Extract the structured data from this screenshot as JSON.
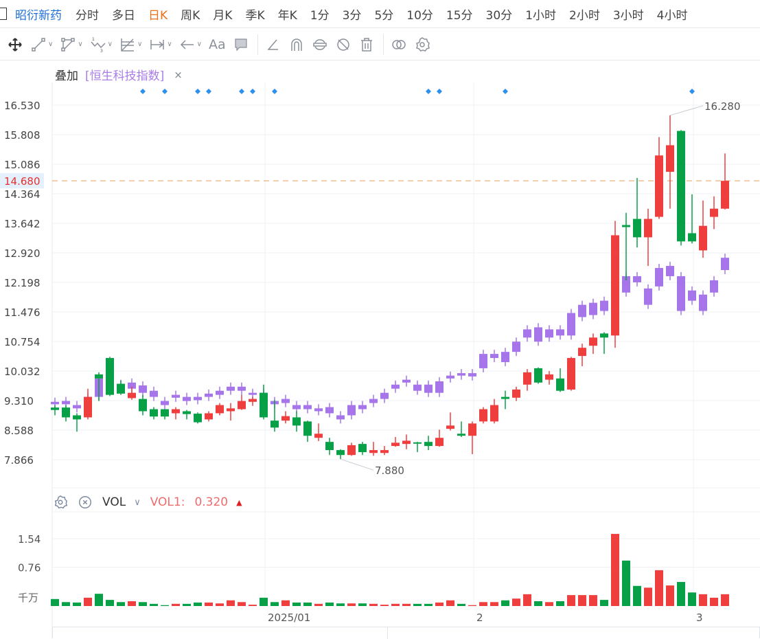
{
  "tabs": {
    "stock_name": "昭衍新药",
    "items": [
      "分时",
      "多日",
      "日K",
      "周K",
      "月K",
      "季K",
      "年K",
      "1分",
      "3分",
      "5分",
      "10分",
      "15分",
      "30分",
      "1小时",
      "2小时",
      "3小时",
      "4小时"
    ],
    "active": "日K"
  },
  "toolbar": {
    "icons": [
      "move-icon",
      "line-tool-icon",
      "polyline-tool-icon",
      "wave-tool-icon",
      "fib-tool-icon",
      "range-tool-icon",
      "arrow-tool-icon",
      "text-tool-icon",
      "comment-tool-icon",
      "angle-tool-icon",
      "magnet-icon",
      "lock-drawings-icon",
      "hide-drawings-icon",
      "delete-icon",
      "compare-icon",
      "settings-icon"
    ],
    "text_label": "Aa"
  },
  "overlay": {
    "label": "叠加",
    "index": "[恒生科技指数]",
    "close": "×"
  },
  "colors": {
    "up": "#ef3e3e",
    "down": "#07a046",
    "overlay": "#a675ea",
    "marker": "#2b8ef0",
    "current": "#e0a060",
    "grid": "#eef1f5"
  },
  "chart_data": {
    "type": "candlestick",
    "price_ticks": [
      "16.530",
      "15.808",
      "15.086",
      "14.364",
      "13.642",
      "12.920",
      "12.198",
      "11.476",
      "10.754",
      "10.032",
      "9.310",
      "8.588",
      "7.866"
    ],
    "ylim": [
      7.866,
      16.53
    ],
    "current_price": "14.680",
    "high_label": {
      "text": "16.280",
      "index": 56
    },
    "low_label": {
      "text": "7.880",
      "index": 26
    },
    "x_labels": [
      {
        "text": "2025/01",
        "index": 19
      },
      {
        "text": "2",
        "index": 38
      },
      {
        "text": "3",
        "index": 58
      }
    ],
    "markers": [
      8,
      10,
      13,
      14,
      17,
      18,
      20,
      34,
      35,
      41,
      58
    ],
    "main": [
      [
        9.14,
        9.08,
        9.2,
        8.95
      ],
      [
        9.14,
        8.9,
        9.2,
        8.8
      ],
      [
        8.95,
        8.85,
        9.0,
        8.55
      ],
      [
        8.9,
        9.4,
        9.6,
        8.85
      ],
      [
        9.95,
        9.85,
        10.0,
        9.3
      ],
      [
        10.35,
        9.45,
        10.38,
        9.42
      ],
      [
        9.72,
        9.48,
        9.8,
        9.45
      ],
      [
        9.37,
        9.5,
        9.65,
        9.33
      ],
      [
        9.35,
        9.05,
        9.45,
        8.95
      ],
      [
        9.1,
        8.92,
        9.15,
        8.85
      ],
      [
        9.1,
        8.92,
        9.1,
        8.85
      ],
      [
        9.0,
        9.1,
        9.15,
        8.85
      ],
      [
        9.05,
        8.98,
        9.08,
        8.85
      ],
      [
        8.99,
        8.78,
        9.02,
        8.75
      ],
      [
        8.85,
        9.0,
        9.05,
        8.8
      ],
      [
        9.0,
        9.2,
        9.25,
        8.95
      ],
      [
        9.05,
        9.12,
        9.25,
        8.82
      ],
      [
        9.1,
        9.3,
        9.45,
        9.08
      ],
      [
        9.28,
        9.35,
        9.4,
        9.18
      ],
      [
        9.5,
        8.9,
        9.7,
        8.85
      ],
      [
        8.82,
        8.65,
        9.32,
        8.55
      ],
      [
        8.82,
        8.93,
        9.05,
        8.75
      ],
      [
        8.9,
        8.7,
        9.05,
        8.55
      ],
      [
        8.8,
        8.45,
        8.82,
        8.3
      ],
      [
        8.4,
        8.5,
        8.75,
        8.32
      ],
      [
        8.3,
        8.1,
        8.4,
        7.98
      ],
      [
        8.1,
        7.98,
        8.12,
        7.88
      ],
      [
        7.98,
        8.22,
        8.28,
        7.96
      ],
      [
        8.25,
        8.05,
        8.3,
        7.98
      ],
      [
        8.03,
        8.1,
        8.3,
        7.96
      ],
      [
        8.03,
        8.1,
        8.2,
        7.98
      ],
      [
        8.2,
        8.28,
        8.42,
        8.18
      ],
      [
        8.25,
        8.33,
        8.48,
        8.12
      ],
      [
        8.29,
        8.27,
        8.3,
        8.05
      ],
      [
        8.3,
        8.2,
        8.45,
        8.1
      ],
      [
        8.2,
        8.4,
        8.6,
        8.18
      ],
      [
        8.62,
        8.7,
        9.02,
        8.58
      ],
      [
        8.5,
        8.45,
        8.8,
        8.42
      ],
      [
        8.45,
        8.75,
        8.8,
        8.0
      ],
      [
        8.8,
        9.1,
        9.15,
        8.75
      ],
      [
        8.8,
        9.2,
        9.35,
        8.75
      ],
      [
        9.4,
        9.35,
        9.55,
        9.1
      ],
      [
        9.38,
        9.58,
        9.65,
        9.3
      ],
      [
        9.7,
        10.0,
        10.08,
        9.55
      ],
      [
        10.1,
        9.75,
        10.12,
        9.72
      ],
      [
        9.82,
        9.95,
        10.03,
        9.7
      ],
      [
        9.85,
        9.55,
        10.1,
        9.52
      ],
      [
        9.58,
        10.35,
        10.38,
        9.55
      ],
      [
        10.4,
        10.6,
        10.7,
        10.15
      ],
      [
        10.65,
        10.85,
        10.95,
        10.45
      ],
      [
        10.95,
        10.85,
        10.98,
        10.45
      ],
      [
        10.9,
        13.35,
        13.7,
        10.6
      ],
      [
        13.6,
        13.55,
        13.9,
        12.25
      ],
      [
        13.75,
        13.3,
        14.75,
        13.05
      ],
      [
        13.3,
        13.75,
        14.0,
        12.6
      ],
      [
        13.8,
        15.3,
        15.75,
        13.75
      ],
      [
        14.9,
        15.55,
        16.28,
        14.0
      ],
      [
        15.9,
        13.2,
        15.92,
        13.1
      ],
      [
        13.4,
        13.2,
        14.35,
        13.15
      ],
      [
        12.98,
        13.58,
        14.2,
        12.8
      ],
      [
        13.8,
        14.0,
        14.3,
        13.5
      ],
      [
        14.0,
        14.68,
        15.35,
        13.98
      ]
    ],
    "overlay": [
      [
        9.28,
        9.22
      ],
      [
        9.3,
        9.22
      ],
      [
        9.2,
        9.12
      ],
      [
        9.4,
        9.35
      ],
      [
        9.85,
        9.4
      ],
      [
        9.7,
        9.6
      ],
      [
        9.72,
        9.65
      ],
      [
        9.75,
        9.6
      ],
      [
        9.68,
        9.5
      ],
      [
        9.55,
        9.4
      ],
      [
        9.3,
        9.2
      ],
      [
        9.45,
        9.38
      ],
      [
        9.4,
        9.3
      ],
      [
        9.4,
        9.32
      ],
      [
        9.48,
        9.4
      ],
      [
        9.55,
        9.45
      ],
      [
        9.65,
        9.55
      ],
      [
        9.65,
        9.55
      ],
      [
        9.5,
        9.45
      ],
      [
        9.5,
        9.45
      ],
      [
        9.3,
        9.22
      ],
      [
        9.35,
        9.25
      ],
      [
        9.2,
        9.1
      ],
      [
        9.2,
        9.1
      ],
      [
        9.12,
        9.05
      ],
      [
        9.15,
        9.0
      ],
      [
        8.95,
        8.85
      ],
      [
        9.2,
        8.95
      ],
      [
        9.2,
        9.1
      ],
      [
        9.35,
        9.25
      ],
      [
        9.5,
        9.35
      ],
      [
        9.7,
        9.6
      ],
      [
        9.82,
        9.75
      ],
      [
        9.7,
        9.55
      ],
      [
        9.7,
        9.5
      ],
      [
        9.78,
        9.5
      ],
      [
        9.92,
        9.85
      ],
      [
        9.98,
        9.92
      ],
      [
        9.98,
        9.9
      ],
      [
        10.45,
        10.1
      ],
      [
        10.45,
        10.35
      ],
      [
        10.5,
        10.25
      ],
      [
        10.75,
        10.5
      ],
      [
        11.05,
        10.85
      ],
      [
        11.1,
        10.75
      ],
      [
        11.05,
        10.85
      ],
      [
        11.05,
        10.9
      ],
      [
        11.45,
        10.9
      ],
      [
        11.65,
        11.35
      ],
      [
        11.7,
        11.4
      ],
      [
        11.75,
        11.5
      ],
      [
        11.6,
        11.5
      ],
      [
        12.35,
        11.95
      ],
      [
        12.35,
        12.2
      ],
      [
        12.05,
        11.65
      ],
      [
        12.55,
        12.1
      ],
      [
        12.6,
        12.35
      ],
      [
        12.35,
        11.5
      ],
      [
        12.0,
        11.75
      ],
      [
        11.9,
        11.5
      ],
      [
        12.25,
        11.95
      ],
      [
        12.8,
        12.5
      ]
    ],
    "volume": {
      "unit": "千万",
      "ticks": [
        "1.54",
        "0.76"
      ],
      "values": [
        0.16,
        0.09,
        0.08,
        0.19,
        0.28,
        0.14,
        0.09,
        0.11,
        0.09,
        0.05,
        0.02,
        0.05,
        0.05,
        0.08,
        0.08,
        0.06,
        0.13,
        0.09,
        0.03,
        0.19,
        0.09,
        0.13,
        0.08,
        0.08,
        0.05,
        0.08,
        0.06,
        0.06,
        0.06,
        0.05,
        0.03,
        0.05,
        0.05,
        0.05,
        0.05,
        0.08,
        0.13,
        0.05,
        0.02,
        0.09,
        0.09,
        0.13,
        0.17,
        0.27,
        0.11,
        0.09,
        0.11,
        0.25,
        0.25,
        0.25,
        0.14,
        1.65,
        1.04,
        0.46,
        0.42,
        0.82,
        0.47,
        0.55,
        0.31,
        0.27,
        0.19,
        0.27
      ]
    }
  },
  "volume_header": {
    "name": "VOL",
    "series_label": "VOL1:",
    "series_value": "0.320",
    "trend": "▲"
  }
}
